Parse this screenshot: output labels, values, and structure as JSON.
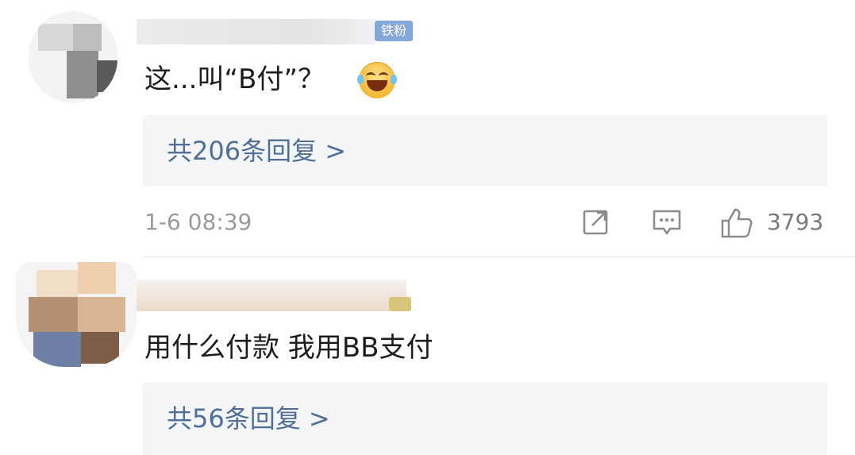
{
  "comments": [
    {
      "badge": "铁粉",
      "text": "这...叫“B付”？",
      "emoji": "laughing-tears-emoji",
      "replies_label": "共206条回复 >",
      "time": "1-6 08:39",
      "likes": "3793"
    },
    {
      "text": "用什么付款 我用BB支付",
      "replies_label": "共56条回复 >"
    }
  ],
  "colors": {
    "link": "#4f6f99",
    "meta": "#9a9a9a",
    "reply_bg": "#f4f5f7",
    "badge": "#86a8d8"
  }
}
